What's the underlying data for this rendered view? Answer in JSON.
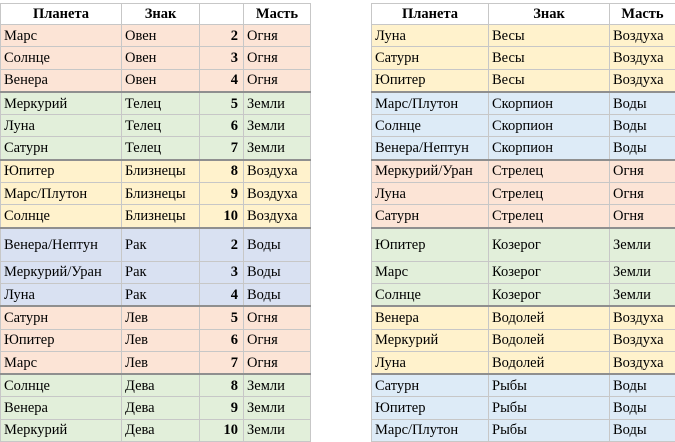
{
  "headers": {
    "planet": "Планета",
    "sign": "Знак",
    "num": "",
    "suit": "Масть"
  },
  "left_rows": [
    {
      "planet": "Марс",
      "sign": "Овен",
      "num": "2",
      "suit": "Огня",
      "elem": "fire"
    },
    {
      "planet": "Солнце",
      "sign": "Овен",
      "num": "3",
      "suit": "Огня",
      "elem": "fire"
    },
    {
      "planet": "Венера",
      "sign": "Овен",
      "num": "4",
      "suit": "Огня",
      "elem": "fire"
    },
    {
      "planet": "Меркурий",
      "sign": "Телец",
      "num": "5",
      "suit": "Земли",
      "elem": "earth"
    },
    {
      "planet": "Луна",
      "sign": "Телец",
      "num": "6",
      "suit": "Земли",
      "elem": "earth"
    },
    {
      "planet": "Сатурн",
      "sign": "Телец",
      "num": "7",
      "suit": "Земли",
      "elem": "earth"
    },
    {
      "planet": "Юпитер",
      "sign": "Близнецы",
      "num": "8",
      "suit": "Воздуха",
      "elem": "air"
    },
    {
      "planet": "Марс/Плутон",
      "sign": "Близнецы",
      "num": "9",
      "suit": "Воздуха",
      "elem": "air"
    },
    {
      "planet": "Солнце",
      "sign": "Близнецы",
      "num": "10",
      "suit": "Воздуха",
      "elem": "air"
    },
    {
      "planet": "Венера/Нептун",
      "sign": "Рак",
      "num": "2",
      "suit": "Воды",
      "elem": "water"
    },
    {
      "planet": "Меркурий/Уран",
      "sign": "Рак",
      "num": "3",
      "suit": "Воды",
      "elem": "water"
    },
    {
      "planet": "Луна",
      "sign": "Рак",
      "num": "4",
      "suit": "Воды",
      "elem": "water"
    },
    {
      "planet": "Сатурн",
      "sign": "Лев",
      "num": "5",
      "suit": "Огня",
      "elem": "fire"
    },
    {
      "planet": "Юпитер",
      "sign": "Лев",
      "num": "6",
      "suit": "Огня",
      "elem": "fire"
    },
    {
      "planet": "Марс",
      "sign": "Лев",
      "num": "7",
      "suit": "Огня",
      "elem": "fire"
    },
    {
      "planet": "Солнце",
      "sign": "Дева",
      "num": "8",
      "suit": "Земли",
      "elem": "earth"
    },
    {
      "planet": "Венера",
      "sign": "Дева",
      "num": "9",
      "suit": "Земли",
      "elem": "earth"
    },
    {
      "planet": "Меркурий",
      "sign": "Дева",
      "num": "10",
      "suit": "Земли",
      "elem": "earth"
    }
  ],
  "right_rows": [
    {
      "planet": "Луна",
      "sign": "Весы",
      "num": "2",
      "suit": "Воздуха",
      "elem": "air"
    },
    {
      "planet": "Сатурн",
      "sign": "Весы",
      "num": "3",
      "suit": "Воздуха",
      "elem": "air"
    },
    {
      "planet": "Юпитер",
      "sign": "Весы",
      "num": "4",
      "suit": "Воздуха",
      "elem": "air"
    },
    {
      "planet": "Марс/Плутон",
      "sign": "Скорпион",
      "num": "5",
      "suit": "Воды",
      "elem": "water2"
    },
    {
      "planet": "Солнце",
      "sign": "Скорпион",
      "num": "6",
      "suit": "Воды",
      "elem": "water2"
    },
    {
      "planet": "Венера/Нептун",
      "sign": "Скорпион",
      "num": "7",
      "suit": "Воды",
      "elem": "water2"
    },
    {
      "planet": "Меркурий/Уран",
      "sign": "Стрелец",
      "num": "8",
      "suit": "Огня",
      "elem": "fire"
    },
    {
      "planet": "Луна",
      "sign": "Стрелец",
      "num": "9",
      "suit": "Огня",
      "elem": "fire"
    },
    {
      "planet": "Сатурн",
      "sign": "Стрелец",
      "num": "10",
      "suit": "Огня",
      "elem": "fire"
    },
    {
      "planet": "Юпитер",
      "sign": "Козерог",
      "num": "2",
      "suit": "Земли",
      "elem": "earth"
    },
    {
      "planet": "Марс",
      "sign": "Козерог",
      "num": "3",
      "suit": "Земли",
      "elem": "earth"
    },
    {
      "planet": "Солнце",
      "sign": "Козерог",
      "num": "4",
      "suit": "Земли",
      "elem": "earth"
    },
    {
      "planet": "Венера",
      "sign": "Водолей",
      "num": "5",
      "suit": "Воздуха",
      "elem": "air"
    },
    {
      "planet": "Меркурий",
      "sign": "Водолей",
      "num": "6",
      "suit": "Воздуха",
      "elem": "air"
    },
    {
      "planet": "Луна",
      "sign": "Водолей",
      "num": "7",
      "suit": "Воздуха",
      "elem": "air"
    },
    {
      "planet": "Сатурн",
      "sign": "Рыбы",
      "num": "8",
      "suit": "Воды",
      "elem": "water2"
    },
    {
      "planet": "Юпитер",
      "sign": "Рыбы",
      "num": "9",
      "suit": "Воды",
      "elem": "water2"
    },
    {
      "planet": "Марс/Плутон",
      "sign": "Рыбы",
      "num": "10",
      "suit": "Воды",
      "elem": "water2"
    }
  ]
}
